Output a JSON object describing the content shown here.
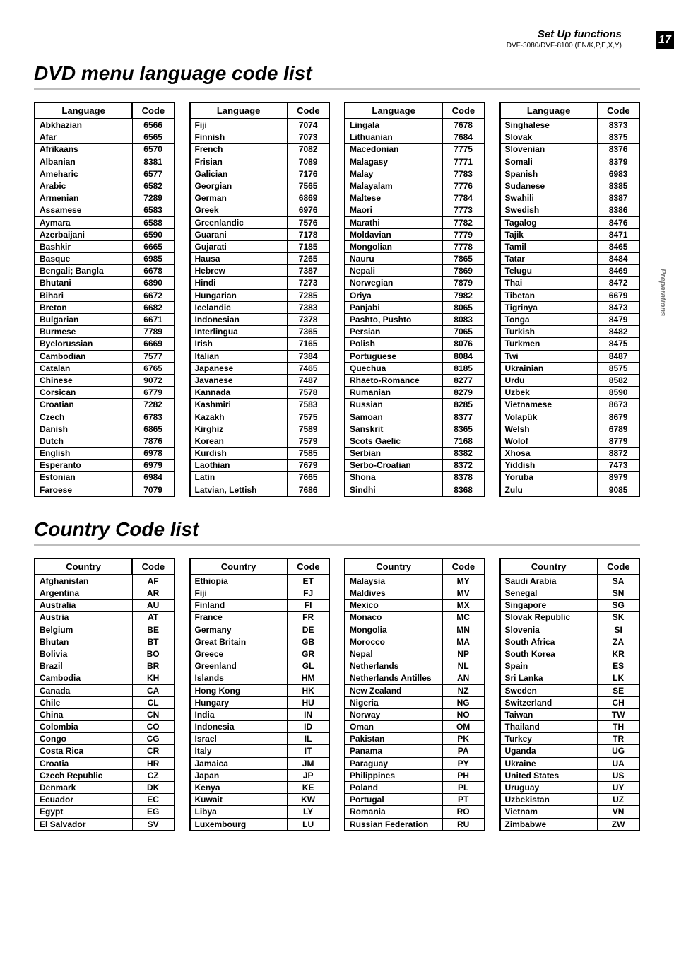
{
  "header": {
    "setup": "Set Up functions",
    "page_no": "17",
    "model": "DVF-3080/DVF-8100 (EN/K,P,E,X,Y)",
    "side_tab": "Preparations"
  },
  "sections": {
    "lang_title": "DVD menu language code list",
    "country_title": "Country Code list"
  },
  "lang_tables": {
    "headers": {
      "name": "Language",
      "code": "Code"
    },
    "cols": [
      [
        {
          "n": "Abkhazian",
          "c": "6566"
        },
        {
          "n": "Afar",
          "c": "6565"
        },
        {
          "n": "Afrikaans",
          "c": "6570"
        },
        {
          "n": "Albanian",
          "c": "8381"
        },
        {
          "n": "Ameharic",
          "c": "6577"
        },
        {
          "n": "Arabic",
          "c": "6582"
        },
        {
          "n": "Armenian",
          "c": "7289"
        },
        {
          "n": "Assamese",
          "c": "6583"
        },
        {
          "n": "Aymara",
          "c": "6588"
        },
        {
          "n": "Azerbaijani",
          "c": "6590"
        },
        {
          "n": "Bashkir",
          "c": "6665"
        },
        {
          "n": "Basque",
          "c": "6985"
        },
        {
          "n": "Bengali; Bangla",
          "c": "6678"
        },
        {
          "n": "Bhutani",
          "c": "6890"
        },
        {
          "n": "Bihari",
          "c": "6672"
        },
        {
          "n": "Breton",
          "c": "6682"
        },
        {
          "n": "Bulgarian",
          "c": "6671"
        },
        {
          "n": "Burmese",
          "c": "7789"
        },
        {
          "n": "Byelorussian",
          "c": "6669"
        },
        {
          "n": "Cambodian",
          "c": "7577"
        },
        {
          "n": "Catalan",
          "c": "6765"
        },
        {
          "n": "Chinese",
          "c": "9072"
        },
        {
          "n": "Corsican",
          "c": "6779"
        },
        {
          "n": "Croatian",
          "c": "7282"
        },
        {
          "n": "Czech",
          "c": "6783"
        },
        {
          "n": "Danish",
          "c": "6865"
        },
        {
          "n": "Dutch",
          "c": "7876"
        },
        {
          "n": "English",
          "c": "6978"
        },
        {
          "n": "Esperanto",
          "c": "6979"
        },
        {
          "n": "Estonian",
          "c": "6984"
        },
        {
          "n": "Faroese",
          "c": "7079"
        }
      ],
      [
        {
          "n": "Fiji",
          "c": "7074"
        },
        {
          "n": "Finnish",
          "c": "7073"
        },
        {
          "n": "French",
          "c": "7082"
        },
        {
          "n": "Frisian",
          "c": "7089"
        },
        {
          "n": "Galician",
          "c": "7176"
        },
        {
          "n": "Georgian",
          "c": "7565"
        },
        {
          "n": "German",
          "c": "6869"
        },
        {
          "n": "Greek",
          "c": "6976"
        },
        {
          "n": "Greenlandic",
          "c": "7576"
        },
        {
          "n": "Guarani",
          "c": "7178"
        },
        {
          "n": "Gujarati",
          "c": "7185"
        },
        {
          "n": "Hausa",
          "c": "7265"
        },
        {
          "n": "Hebrew",
          "c": "7387"
        },
        {
          "n": "Hindi",
          "c": "7273"
        },
        {
          "n": "Hungarian",
          "c": "7285"
        },
        {
          "n": "Icelandic",
          "c": "7383"
        },
        {
          "n": "Indonesian",
          "c": "7378"
        },
        {
          "n": "Interlingua",
          "c": "7365"
        },
        {
          "n": "Irish",
          "c": "7165"
        },
        {
          "n": "Italian",
          "c": "7384"
        },
        {
          "n": "Japanese",
          "c": "7465"
        },
        {
          "n": "Javanese",
          "c": "7487"
        },
        {
          "n": "Kannada",
          "c": "7578"
        },
        {
          "n": "Kashmiri",
          "c": "7583"
        },
        {
          "n": "Kazakh",
          "c": "7575"
        },
        {
          "n": "Kirghiz",
          "c": "7589"
        },
        {
          "n": "Korean",
          "c": "7579"
        },
        {
          "n": "Kurdish",
          "c": "7585"
        },
        {
          "n": "Laothian",
          "c": "7679"
        },
        {
          "n": "Latin",
          "c": "7665"
        },
        {
          "n": "Latvian, Lettish",
          "c": "7686"
        }
      ],
      [
        {
          "n": "Lingala",
          "c": "7678"
        },
        {
          "n": "Lithuanian",
          "c": "7684"
        },
        {
          "n": "Macedonian",
          "c": "7775"
        },
        {
          "n": "Malagasy",
          "c": "7771"
        },
        {
          "n": "Malay",
          "c": "7783"
        },
        {
          "n": "Malayalam",
          "c": "7776"
        },
        {
          "n": "Maltese",
          "c": "7784"
        },
        {
          "n": "Maori",
          "c": "7773"
        },
        {
          "n": "Marathi",
          "c": "7782"
        },
        {
          "n": "Moldavian",
          "c": "7779"
        },
        {
          "n": "Mongolian",
          "c": "7778"
        },
        {
          "n": "Nauru",
          "c": "7865"
        },
        {
          "n": "Nepali",
          "c": "7869"
        },
        {
          "n": "Norwegian",
          "c": "7879"
        },
        {
          "n": "Oriya",
          "c": "7982"
        },
        {
          "n": "Panjabi",
          "c": "8065"
        },
        {
          "n": "Pashto, Pushto",
          "c": "8083"
        },
        {
          "n": "Persian",
          "c": "7065"
        },
        {
          "n": "Polish",
          "c": "8076"
        },
        {
          "n": "Portuguese",
          "c": "8084"
        },
        {
          "n": "Quechua",
          "c": "8185"
        },
        {
          "n": "Rhaeto-Romance",
          "c": "8277"
        },
        {
          "n": "Rumanian",
          "c": "8279"
        },
        {
          "n": "Russian",
          "c": "8285"
        },
        {
          "n": "Samoan",
          "c": "8377"
        },
        {
          "n": "Sanskrit",
          "c": "8365"
        },
        {
          "n": "Scots Gaelic",
          "c": "7168"
        },
        {
          "n": "Serbian",
          "c": "8382"
        },
        {
          "n": "Serbo-Croatian",
          "c": "8372"
        },
        {
          "n": "Shona",
          "c": "8378"
        },
        {
          "n": "Sindhi",
          "c": "8368"
        }
      ],
      [
        {
          "n": "Singhalese",
          "c": "8373"
        },
        {
          "n": "Slovak",
          "c": "8375"
        },
        {
          "n": "Slovenian",
          "c": "8376"
        },
        {
          "n": "Somali",
          "c": "8379"
        },
        {
          "n": "Spanish",
          "c": "6983"
        },
        {
          "n": "Sudanese",
          "c": "8385"
        },
        {
          "n": "Swahili",
          "c": "8387"
        },
        {
          "n": "Swedish",
          "c": "8386"
        },
        {
          "n": "Tagalog",
          "c": "8476"
        },
        {
          "n": "Tajik",
          "c": "8471"
        },
        {
          "n": "Tamil",
          "c": "8465"
        },
        {
          "n": "Tatar",
          "c": "8484"
        },
        {
          "n": "Telugu",
          "c": "8469"
        },
        {
          "n": "Thai",
          "c": "8472"
        },
        {
          "n": "Tibetan",
          "c": "6679"
        },
        {
          "n": "Tigrinya",
          "c": "8473"
        },
        {
          "n": "Tonga",
          "c": "8479"
        },
        {
          "n": "Turkish",
          "c": "8482"
        },
        {
          "n": "Turkmen",
          "c": "8475"
        },
        {
          "n": "Twi",
          "c": "8487"
        },
        {
          "n": "Ukrainian",
          "c": "8575"
        },
        {
          "n": "Urdu",
          "c": "8582"
        },
        {
          "n": "Uzbek",
          "c": "8590"
        },
        {
          "n": "Vietnamese",
          "c": "8673"
        },
        {
          "n": "Volapük",
          "c": "8679"
        },
        {
          "n": "Welsh",
          "c": "6789"
        },
        {
          "n": "Wolof",
          "c": "8779"
        },
        {
          "n": "Xhosa",
          "c": "8872"
        },
        {
          "n": "Yiddish",
          "c": "7473"
        },
        {
          "n": "Yoruba",
          "c": "8979"
        },
        {
          "n": "Zulu",
          "c": "9085"
        }
      ]
    ]
  },
  "country_tables": {
    "headers": {
      "name": "Country",
      "code": "Code"
    },
    "cols": [
      [
        {
          "n": "Afghanistan",
          "c": "AF"
        },
        {
          "n": "Argentina",
          "c": "AR"
        },
        {
          "n": "Australia",
          "c": "AU"
        },
        {
          "n": "Austria",
          "c": "AT"
        },
        {
          "n": "Belgium",
          "c": "BE"
        },
        {
          "n": "Bhutan",
          "c": "BT"
        },
        {
          "n": "Bolivia",
          "c": "BO"
        },
        {
          "n": "Brazil",
          "c": "BR"
        },
        {
          "n": "Cambodia",
          "c": "KH"
        },
        {
          "n": "Canada",
          "c": "CA"
        },
        {
          "n": "Chile",
          "c": "CL"
        },
        {
          "n": "China",
          "c": "CN"
        },
        {
          "n": "Colombia",
          "c": "CO"
        },
        {
          "n": "Congo",
          "c": "CG"
        },
        {
          "n": "Costa Rica",
          "c": "CR"
        },
        {
          "n": "Croatia",
          "c": "HR"
        },
        {
          "n": "Czech Republic",
          "c": "CZ"
        },
        {
          "n": "Denmark",
          "c": "DK"
        },
        {
          "n": "Ecuador",
          "c": "EC"
        },
        {
          "n": "Egypt",
          "c": "EG"
        },
        {
          "n": "El Salvador",
          "c": "SV"
        }
      ],
      [
        {
          "n": "Ethiopia",
          "c": "ET"
        },
        {
          "n": "Fiji",
          "c": "FJ"
        },
        {
          "n": "Finland",
          "c": "FI"
        },
        {
          "n": "France",
          "c": "FR"
        },
        {
          "n": "Germany",
          "c": "DE"
        },
        {
          "n": "Great Britain",
          "c": "GB"
        },
        {
          "n": "Greece",
          "c": "GR"
        },
        {
          "n": "Greenland",
          "c": "GL"
        },
        {
          "n": "Islands",
          "c": "HM"
        },
        {
          "n": "Hong Kong",
          "c": "HK"
        },
        {
          "n": "Hungary",
          "c": "HU"
        },
        {
          "n": "India",
          "c": "IN"
        },
        {
          "n": "Indonesia",
          "c": "ID"
        },
        {
          "n": "Israel",
          "c": "IL"
        },
        {
          "n": "Italy",
          "c": "IT"
        },
        {
          "n": "Jamaica",
          "c": "JM"
        },
        {
          "n": "Japan",
          "c": "JP"
        },
        {
          "n": "Kenya",
          "c": "KE"
        },
        {
          "n": "Kuwait",
          "c": "KW"
        },
        {
          "n": "Libya",
          "c": "LY"
        },
        {
          "n": "Luxembourg",
          "c": "LU"
        }
      ],
      [
        {
          "n": "Malaysia",
          "c": "MY"
        },
        {
          "n": "Maldives",
          "c": "MV"
        },
        {
          "n": "Mexico",
          "c": "MX"
        },
        {
          "n": "Monaco",
          "c": "MC"
        },
        {
          "n": "Mongolia",
          "c": "MN"
        },
        {
          "n": "Morocco",
          "c": "MA"
        },
        {
          "n": "Nepal",
          "c": "NP"
        },
        {
          "n": "Netherlands",
          "c": "NL"
        },
        {
          "n": "Netherlands Antilles",
          "c": "AN"
        },
        {
          "n": "New Zealand",
          "c": "NZ"
        },
        {
          "n": "Nigeria",
          "c": "NG"
        },
        {
          "n": "Norway",
          "c": "NO"
        },
        {
          "n": "Oman",
          "c": "OM"
        },
        {
          "n": "Pakistan",
          "c": "PK"
        },
        {
          "n": "Panama",
          "c": "PA"
        },
        {
          "n": "Paraguay",
          "c": "PY"
        },
        {
          "n": "Philippines",
          "c": "PH"
        },
        {
          "n": "Poland",
          "c": "PL"
        },
        {
          "n": "Portugal",
          "c": "PT"
        },
        {
          "n": "Romania",
          "c": "RO"
        },
        {
          "n": "Russian Federation",
          "c": "RU"
        }
      ],
      [
        {
          "n": "Saudi Arabia",
          "c": "SA"
        },
        {
          "n": "Senegal",
          "c": "SN"
        },
        {
          "n": "Singapore",
          "c": "SG"
        },
        {
          "n": "Slovak Republic",
          "c": "SK"
        },
        {
          "n": "Slovenia",
          "c": "SI"
        },
        {
          "n": "South Africa",
          "c": "ZA"
        },
        {
          "n": "South Korea",
          "c": "KR"
        },
        {
          "n": "Spain",
          "c": "ES"
        },
        {
          "n": "Sri Lanka",
          "c": "LK"
        },
        {
          "n": "Sweden",
          "c": "SE"
        },
        {
          "n": "Switzerland",
          "c": "CH"
        },
        {
          "n": "Taiwan",
          "c": "TW"
        },
        {
          "n": "Thailand",
          "c": "TH"
        },
        {
          "n": "Turkey",
          "c": "TR"
        },
        {
          "n": "Uganda",
          "c": "UG"
        },
        {
          "n": "Ukraine",
          "c": "UA"
        },
        {
          "n": "United States",
          "c": "US"
        },
        {
          "n": "Uruguay",
          "c": "UY"
        },
        {
          "n": "Uzbekistan",
          "c": "UZ"
        },
        {
          "n": "Vietnam",
          "c": "VN"
        },
        {
          "n": "Zimbabwe",
          "c": "ZW"
        }
      ]
    ]
  }
}
